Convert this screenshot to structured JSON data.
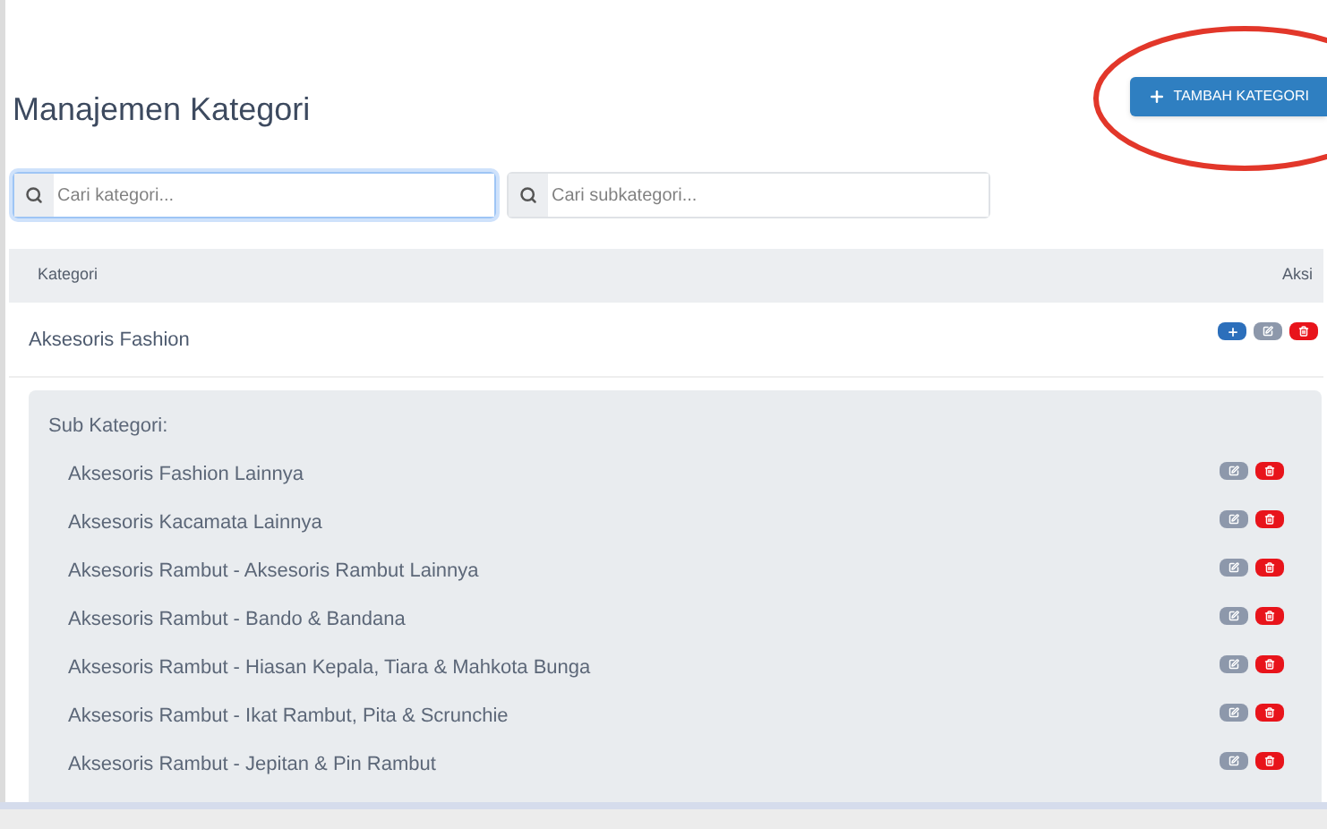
{
  "page_title": "Manajemen Kategori",
  "add_button": {
    "label": "TAMBAH KATEGORI",
    "highlighted": true
  },
  "search": [
    {
      "placeholder": "Cari kategori...",
      "focused": true
    },
    {
      "placeholder": "Cari subkategori...",
      "focused": false
    }
  ],
  "table": {
    "columns": [
      "Kategori",
      "Aksi"
    ],
    "rows": [
      {
        "name": "Aksesoris Fashion",
        "sub_heading": "Sub Kategori:",
        "subcategories": [
          {
            "name": "Aksesoris Fashion Lainnya"
          },
          {
            "name": "Aksesoris Kacamata Lainnya"
          },
          {
            "name": "Aksesoris Rambut - Aksesoris Rambut Lainnya"
          },
          {
            "name": "Aksesoris Rambut - Bando & Bandana"
          },
          {
            "name": "Aksesoris Rambut - Hiasan Kepala, Tiara & Mahkota Bunga"
          },
          {
            "name": "Aksesoris Rambut - Ikat Rambut, Pita & Scrunchie"
          },
          {
            "name": "Aksesoris Rambut - Jepitan & Pin Rambut"
          }
        ]
      }
    ]
  }
}
